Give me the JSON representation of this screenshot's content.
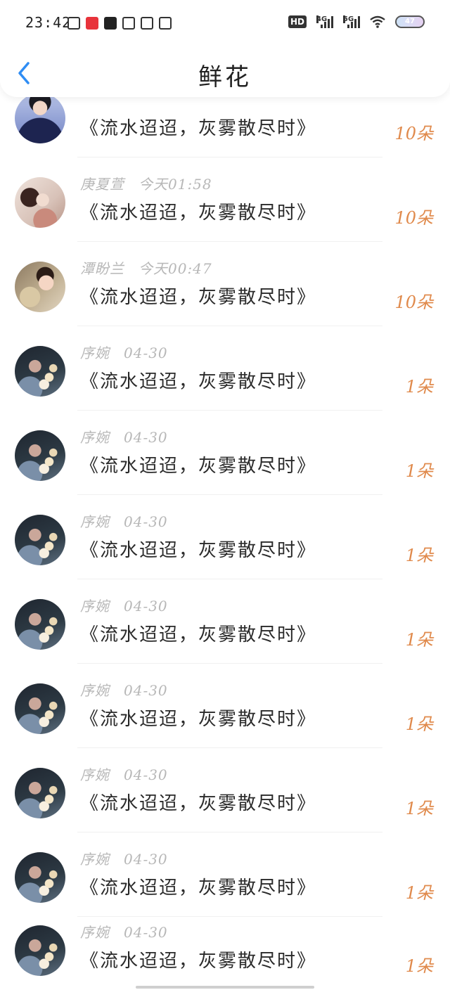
{
  "status_bar": {
    "time": "23:42",
    "battery": "47",
    "signal_1": "4G",
    "signal_2": "5G",
    "hd": "HD"
  },
  "header": {
    "title": "鲜花",
    "back_icon": "chevron-left-icon",
    "accent": "#2f8df4"
  },
  "gifts": [
    {
      "user": "",
      "time": "",
      "title": "《流水迢迢，灰雾散尽时》",
      "count": "10朵",
      "avatar": "uniform"
    },
    {
      "user": "庚夏萱",
      "time": "今天01:58",
      "title": "《流水迢迢，灰雾散尽时》",
      "count": "10朵",
      "avatar": "light"
    },
    {
      "user": "潭盼兰",
      "time": "今天00:47",
      "title": "《流水迢迢，灰雾散尽时》",
      "count": "10朵",
      "avatar": "child"
    },
    {
      "user": "序婉",
      "time": "04-30",
      "title": "《流水迢迢，灰雾散尽时》",
      "count": "1朵",
      "avatar": "dark"
    },
    {
      "user": "序婉",
      "time": "04-30",
      "title": "《流水迢迢，灰雾散尽时》",
      "count": "1朵",
      "avatar": "dark"
    },
    {
      "user": "序婉",
      "time": "04-30",
      "title": "《流水迢迢，灰雾散尽时》",
      "count": "1朵",
      "avatar": "dark"
    },
    {
      "user": "序婉",
      "time": "04-30",
      "title": "《流水迢迢，灰雾散尽时》",
      "count": "1朵",
      "avatar": "dark"
    },
    {
      "user": "序婉",
      "time": "04-30",
      "title": "《流水迢迢，灰雾散尽时》",
      "count": "1朵",
      "avatar": "dark"
    },
    {
      "user": "序婉",
      "time": "04-30",
      "title": "《流水迢迢，灰雾散尽时》",
      "count": "1朵",
      "avatar": "dark"
    },
    {
      "user": "序婉",
      "time": "04-30",
      "title": "《流水迢迢，灰雾散尽时》",
      "count": "1朵",
      "avatar": "dark"
    },
    {
      "user": "序婉",
      "time": "04-30",
      "title": "《流水迢迢，灰雾散尽时》",
      "count": "1朵",
      "avatar": "dark"
    }
  ],
  "colors": {
    "count": "#e08a4c",
    "meta": "#b7b7b7"
  }
}
